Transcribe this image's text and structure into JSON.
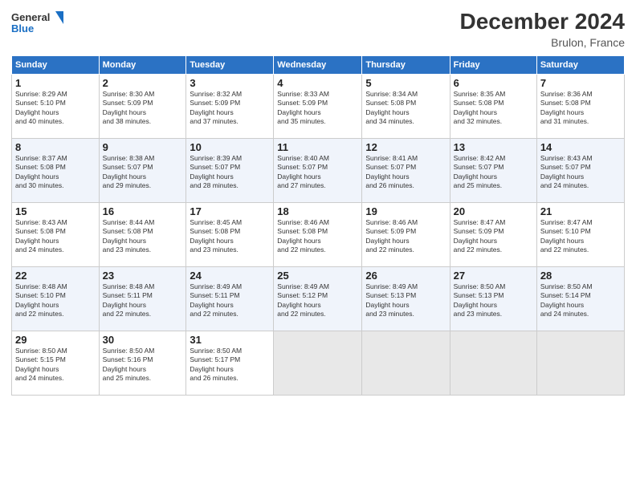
{
  "header": {
    "logo_line1": "General",
    "logo_line2": "Blue",
    "title": "December 2024",
    "subtitle": "Brulon, France"
  },
  "days_of_week": [
    "Sunday",
    "Monday",
    "Tuesday",
    "Wednesday",
    "Thursday",
    "Friday",
    "Saturday"
  ],
  "weeks": [
    [
      {
        "num": "1",
        "sunrise": "8:29 AM",
        "sunset": "5:10 PM",
        "daylight": "8 hours and 40 minutes."
      },
      {
        "num": "2",
        "sunrise": "8:30 AM",
        "sunset": "5:09 PM",
        "daylight": "8 hours and 38 minutes."
      },
      {
        "num": "3",
        "sunrise": "8:32 AM",
        "sunset": "5:09 PM",
        "daylight": "8 hours and 37 minutes."
      },
      {
        "num": "4",
        "sunrise": "8:33 AM",
        "sunset": "5:09 PM",
        "daylight": "8 hours and 35 minutes."
      },
      {
        "num": "5",
        "sunrise": "8:34 AM",
        "sunset": "5:08 PM",
        "daylight": "8 hours and 34 minutes."
      },
      {
        "num": "6",
        "sunrise": "8:35 AM",
        "sunset": "5:08 PM",
        "daylight": "8 hours and 32 minutes."
      },
      {
        "num": "7",
        "sunrise": "8:36 AM",
        "sunset": "5:08 PM",
        "daylight": "8 hours and 31 minutes."
      }
    ],
    [
      {
        "num": "8",
        "sunrise": "8:37 AM",
        "sunset": "5:08 PM",
        "daylight": "8 hours and 30 minutes."
      },
      {
        "num": "9",
        "sunrise": "8:38 AM",
        "sunset": "5:07 PM",
        "daylight": "8 hours and 29 minutes."
      },
      {
        "num": "10",
        "sunrise": "8:39 AM",
        "sunset": "5:07 PM",
        "daylight": "8 hours and 28 minutes."
      },
      {
        "num": "11",
        "sunrise": "8:40 AM",
        "sunset": "5:07 PM",
        "daylight": "8 hours and 27 minutes."
      },
      {
        "num": "12",
        "sunrise": "8:41 AM",
        "sunset": "5:07 PM",
        "daylight": "8 hours and 26 minutes."
      },
      {
        "num": "13",
        "sunrise": "8:42 AM",
        "sunset": "5:07 PM",
        "daylight": "8 hours and 25 minutes."
      },
      {
        "num": "14",
        "sunrise": "8:43 AM",
        "sunset": "5:07 PM",
        "daylight": "8 hours and 24 minutes."
      }
    ],
    [
      {
        "num": "15",
        "sunrise": "8:43 AM",
        "sunset": "5:08 PM",
        "daylight": "8 hours and 24 minutes."
      },
      {
        "num": "16",
        "sunrise": "8:44 AM",
        "sunset": "5:08 PM",
        "daylight": "8 hours and 23 minutes."
      },
      {
        "num": "17",
        "sunrise": "8:45 AM",
        "sunset": "5:08 PM",
        "daylight": "8 hours and 23 minutes."
      },
      {
        "num": "18",
        "sunrise": "8:46 AM",
        "sunset": "5:08 PM",
        "daylight": "8 hours and 22 minutes."
      },
      {
        "num": "19",
        "sunrise": "8:46 AM",
        "sunset": "5:09 PM",
        "daylight": "8 hours and 22 minutes."
      },
      {
        "num": "20",
        "sunrise": "8:47 AM",
        "sunset": "5:09 PM",
        "daylight": "8 hours and 22 minutes."
      },
      {
        "num": "21",
        "sunrise": "8:47 AM",
        "sunset": "5:10 PM",
        "daylight": "8 hours and 22 minutes."
      }
    ],
    [
      {
        "num": "22",
        "sunrise": "8:48 AM",
        "sunset": "5:10 PM",
        "daylight": "8 hours and 22 minutes."
      },
      {
        "num": "23",
        "sunrise": "8:48 AM",
        "sunset": "5:11 PM",
        "daylight": "8 hours and 22 minutes."
      },
      {
        "num": "24",
        "sunrise": "8:49 AM",
        "sunset": "5:11 PM",
        "daylight": "8 hours and 22 minutes."
      },
      {
        "num": "25",
        "sunrise": "8:49 AM",
        "sunset": "5:12 PM",
        "daylight": "8 hours and 22 minutes."
      },
      {
        "num": "26",
        "sunrise": "8:49 AM",
        "sunset": "5:13 PM",
        "daylight": "8 hours and 23 minutes."
      },
      {
        "num": "27",
        "sunrise": "8:50 AM",
        "sunset": "5:13 PM",
        "daylight": "8 hours and 23 minutes."
      },
      {
        "num": "28",
        "sunrise": "8:50 AM",
        "sunset": "5:14 PM",
        "daylight": "8 hours and 24 minutes."
      }
    ],
    [
      {
        "num": "29",
        "sunrise": "8:50 AM",
        "sunset": "5:15 PM",
        "daylight": "8 hours and 24 minutes."
      },
      {
        "num": "30",
        "sunrise": "8:50 AM",
        "sunset": "5:16 PM",
        "daylight": "8 hours and 25 minutes."
      },
      {
        "num": "31",
        "sunrise": "8:50 AM",
        "sunset": "5:17 PM",
        "daylight": "8 hours and 26 minutes."
      },
      null,
      null,
      null,
      null
    ]
  ]
}
